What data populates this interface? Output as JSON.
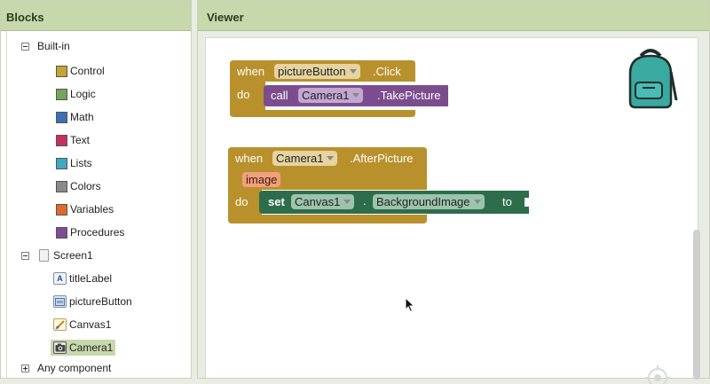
{
  "blocks_panel": {
    "title": "Blocks",
    "builtin": {
      "label": "Built-in",
      "items": [
        {
          "label": "Control",
          "color": "#c8a232"
        },
        {
          "label": "Logic",
          "color": "#73a55a"
        },
        {
          "label": "Math",
          "color": "#3c6fb5"
        },
        {
          "label": "Text",
          "color": "#c6315d"
        },
        {
          "label": "Lists",
          "color": "#3ea8c2"
        },
        {
          "label": "Colors",
          "color": "#8a8a8a"
        },
        {
          "label": "Variables",
          "color": "#e0682a"
        },
        {
          "label": "Procedures",
          "color": "#7e4c96"
        }
      ]
    },
    "screen": {
      "label": "Screen1",
      "components": [
        {
          "label": "titleLabel",
          "icon": "label-icon"
        },
        {
          "label": "pictureButton",
          "icon": "button-icon"
        },
        {
          "label": "Canvas1",
          "icon": "canvas-icon"
        },
        {
          "label": "Camera1",
          "icon": "camera-icon"
        }
      ]
    },
    "any_component": "Any component"
  },
  "viewer": {
    "title": "Viewer",
    "block1": {
      "when": "when",
      "component": "pictureButton",
      "event": ".Click",
      "do": "do",
      "call": "call",
      "call_component": "Camera1",
      "method": ".TakePicture"
    },
    "block2": {
      "when": "when",
      "component": "Camera1",
      "event": ".AfterPicture",
      "param": "image",
      "do": "do",
      "set": "set",
      "set_component": "Canvas1",
      "dot": ".",
      "property": "BackgroundImage",
      "to": "to"
    }
  },
  "colors": {
    "event_block": "#b9912c",
    "method_block": "#7b4d8f",
    "setter_block": "#2e6d4c",
    "header": "#c7d8ac"
  }
}
